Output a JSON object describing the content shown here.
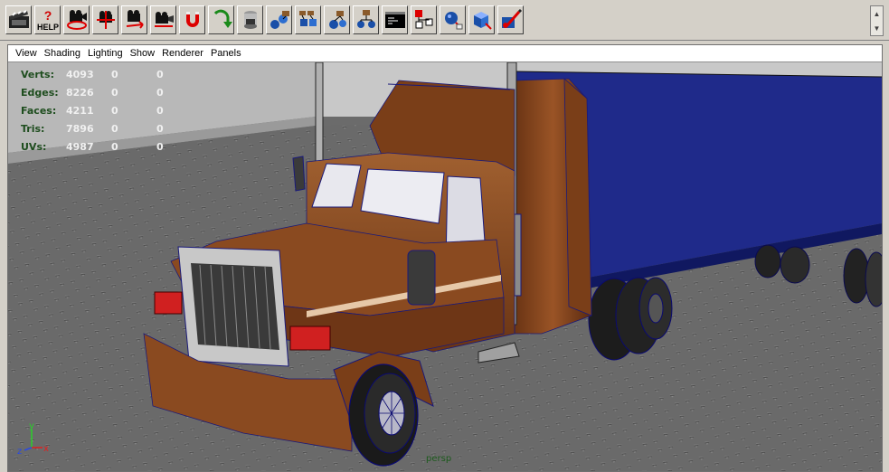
{
  "shelf": {
    "help_label": "HELP",
    "tools": [
      "clapper-icon",
      "help-icon",
      "camera-tumble-icon",
      "camera-track-icon",
      "camera-dolly-icon",
      "camera-zoom-icon",
      "magnet-icon",
      "redo-arrow-icon",
      "cup-icon",
      "hierarchy-a-icon",
      "hierarchy-b-icon",
      "hierarchy-c-icon",
      "hierarchy-d-icon",
      "script-editor-icon",
      "hypergraph-icon",
      "sphere-select-icon",
      "cube-select-icon",
      "paint-effects-icon"
    ]
  },
  "menubar": [
    "View",
    "Shading",
    "Lighting",
    "Show",
    "Renderer",
    "Panels"
  ],
  "hud": [
    {
      "label": "Verts:",
      "value": "4093",
      "c1": "0",
      "c2": "0"
    },
    {
      "label": "Edges:",
      "value": "8226",
      "c1": "0",
      "c2": "0"
    },
    {
      "label": "Faces:",
      "value": "4211",
      "c1": "0",
      "c2": "0"
    },
    {
      "label": "Tris:",
      "value": "7896",
      "c1": "0",
      "c2": "0"
    },
    {
      "label": "UVs:",
      "value": "4987",
      "c1": "0",
      "c2": "0"
    }
  ],
  "camera_name": "persp",
  "axis": {
    "y": "y",
    "x": "x",
    "z": "z"
  },
  "colors": {
    "truck_body": "#8a4a20",
    "truck_dark": "#5a2c10",
    "trailer": "#1f2a8a",
    "wireframe": "#1a1a7a",
    "floor": "#6e6e6e",
    "hud_label": "#1e4d1e"
  }
}
